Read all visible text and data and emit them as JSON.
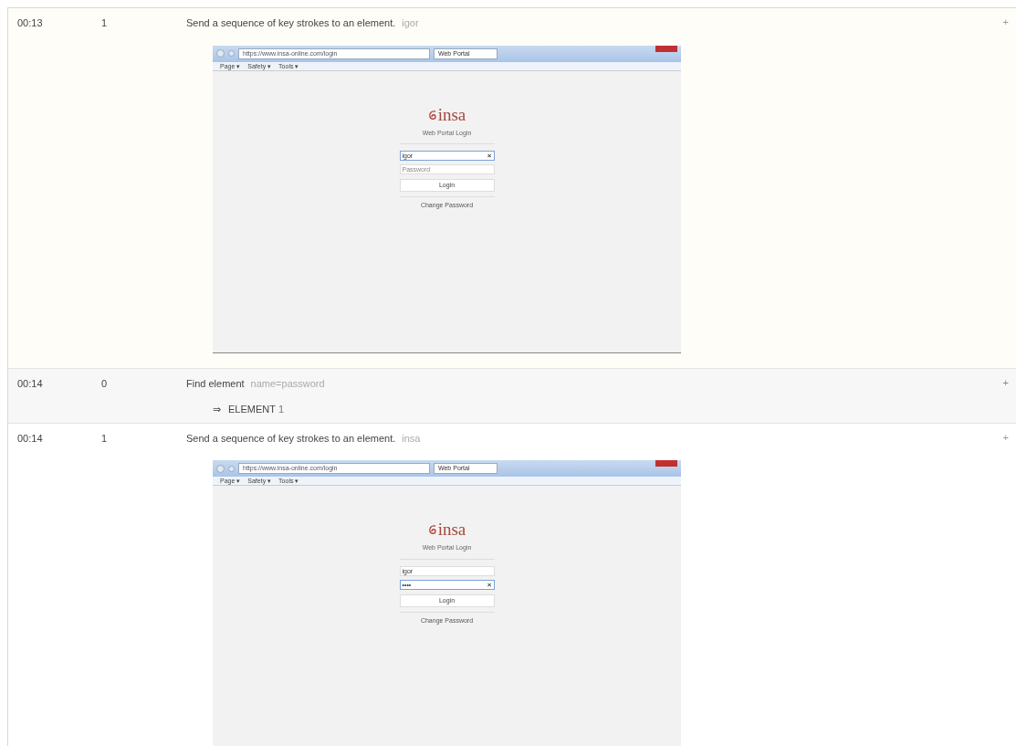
{
  "log_rows": [
    {
      "time": "00:13",
      "level": "1",
      "action": "Send a sequence of key strokes to an element.",
      "argument": "igor",
      "toggle": "+",
      "expanded": true,
      "screenshot": {
        "url": "https://www.insa-online.com/login",
        "tab_title": "Web Portal",
        "menus": [
          "Page ▾",
          "Safety ▾",
          "Tools ▾"
        ],
        "logo": "insa",
        "heading": "Web Portal Login",
        "fields": [
          {
            "value": "igor",
            "focused": true,
            "clear_icon": "×"
          },
          {
            "placeholder": "Password",
            "focused": false
          }
        ],
        "button": "Login",
        "link": "Change Password"
      }
    },
    {
      "time": "00:14",
      "level": "0",
      "action": "Find element",
      "argument": "name=password",
      "toggle": "+",
      "expanded": false,
      "result": {
        "arrow": "⇒",
        "label": "ELEMENT",
        "value": "1"
      }
    },
    {
      "time": "00:14",
      "level": "1",
      "action": "Send a sequence of key strokes to an element.",
      "argument": "insa",
      "toggle": "+",
      "expanded": true,
      "screenshot": {
        "url": "https://www.insa-online.com/login",
        "tab_title": "Web Portal",
        "menus": [
          "Page ▾",
          "Safety ▾",
          "Tools ▾"
        ],
        "logo": "insa",
        "heading": "Web Portal Login",
        "fields": [
          {
            "value": "igor",
            "focused": false
          },
          {
            "value": "••••",
            "focused": true,
            "clear_icon": "×"
          }
        ],
        "button": "Login",
        "link": "Change Password"
      }
    }
  ]
}
